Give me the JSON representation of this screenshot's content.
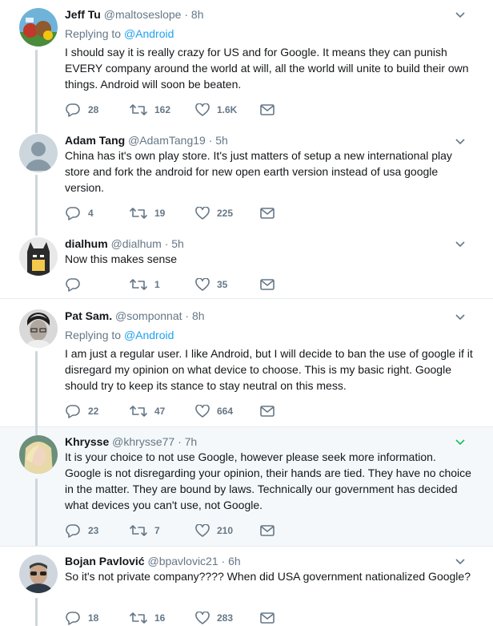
{
  "tweets": [
    {
      "name": "Jeff Tu",
      "handle": "@maltoseslope",
      "time": "8h",
      "replying_label": "Replying to",
      "replying_to": "@Android",
      "text": "I should say it is really crazy for US and for Google. It means they can punish EVERY company around the world at will, all the world will unite to build their own things. Android will soon be beaten.",
      "replies": "28",
      "retweets": "162",
      "likes": "1.6K"
    },
    {
      "name": "Adam Tang",
      "handle": "@AdamTang19",
      "time": "5h",
      "text": "China has it's own play store. It's just matters of setup a new international play store and fork the android for new open earth version instead of usa google version.",
      "replies": "4",
      "retweets": "19",
      "likes": "225"
    },
    {
      "name": "dialhum",
      "handle": "@dialhum",
      "time": "5h",
      "text": "Now this makes sense",
      "replies": "",
      "retweets": "1",
      "likes": "35"
    },
    {
      "name": "Pat Sam.",
      "handle": "@somponnat",
      "time": "8h",
      "replying_label": "Replying to",
      "replying_to": "@Android",
      "text": "I am just a regular user. I like Android, but I will decide to ban the use of google if it disregard my opinion on what device to choose. This is my basic right. Google should try to keep its stance to stay neutral on this mess.",
      "replies": "22",
      "retweets": "47",
      "likes": "664"
    },
    {
      "name": "Khrysse",
      "handle": "@khrysse77",
      "time": "7h",
      "text": "It is your choice to not use Google, however please seek more information. Google is not disregarding your opinion, their hands are tied. They have no choice in the matter. They are bound by laws. Technically our government has decided what devices you can't use, not Google.",
      "replies": "23",
      "retweets": "7",
      "likes": "210"
    },
    {
      "name": "Bojan Pavlović",
      "handle": "@bpavlovic21",
      "time": "6h",
      "text": "So it's not private company???? When did USA government nationalized Google?",
      "replies": "18",
      "retweets": "16",
      "likes": "283"
    }
  ],
  "separator": "·",
  "colors": {
    "text": "#14171a",
    "secondary": "#657786",
    "link": "#1da1f2",
    "thread_line": "#ccd6dd",
    "highlight_bg": "#f5f8fa",
    "highlight_caret": "#17bf63"
  },
  "icons": [
    "reply-icon",
    "retweet-icon",
    "like-icon",
    "message-icon",
    "chevron-down-icon"
  ]
}
